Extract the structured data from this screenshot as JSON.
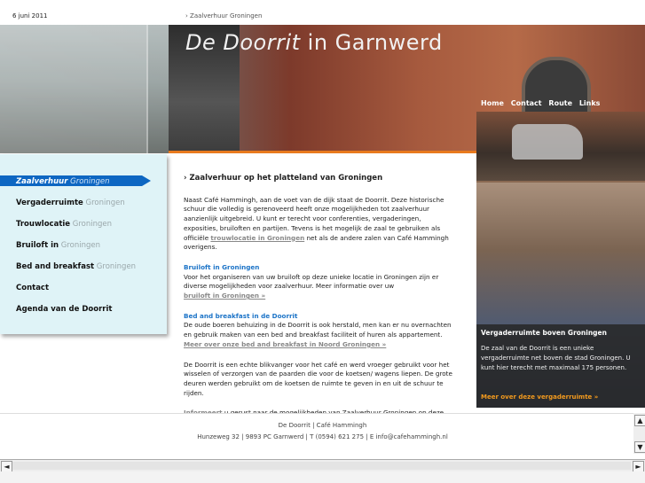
{
  "topbar": {
    "date": "6 juni 2011",
    "breadcrumb": "› Zaalverhuur Groningen"
  },
  "banner": {
    "title_italic": "De Doorrit",
    "title_rest": " in Garnwerd",
    "nav": [
      "Home",
      "Contact",
      "Route",
      "Links"
    ]
  },
  "sidebar": {
    "items": [
      {
        "main": "Zaalverhuur",
        "sub": " Groningen",
        "active": true
      },
      {
        "main": "Vergaderruimte",
        "sub": " Groningen"
      },
      {
        "main": "Trouwlocatie",
        "sub": " Groningen"
      },
      {
        "main": "Bruiloft in",
        "sub": " Groningen"
      },
      {
        "main": "Bed and breakfast",
        "sub": " Groningen"
      },
      {
        "main": "Contact",
        "sub": ""
      },
      {
        "main": "Agenda van de Doorrit",
        "sub": ""
      }
    ]
  },
  "content": {
    "heading": "› Zaalverhuur op het platteland van Groningen",
    "p1": "Naast Café Hammingh, aan de voet van de dijk staat de Doorrit. Deze historische schuur die volledig is gerenoveerd heeft onze mogelijkheden tot zaalverhuur aanzienlijk uitgebreid. U kunt er terecht voor conferenties, vergaderingen, exposities, bruiloften en partijen. Tevens is het mogelijk de zaal te gebruiken als officiële ",
    "p1_link": "trouwlocatie in Groningen",
    "p1_end": " net als de andere zalen van Café Hammingh overigens.",
    "h2": "Bruiloft in Groningen",
    "p2": "Voor het organiseren van uw bruiloft op deze unieke locatie in Groningen zijn er diverse mogelijkheden voor zaalverhuur. Meer informatie over uw",
    "p2_link": "bruiloft in Groningen »",
    "h3": "Bed and breakfast in de Doorrit",
    "p3": "De oude boeren behuizing in de Doorrit is ook herstald, men kan er nu overnachten en gebruik maken van een bed and breakfast faciliteit of huren als appartement. ",
    "p3_link": "Meer over onze bed and breakfast in Noord Groningen »",
    "p4": "De Doorrit is een echte blikvanger voor het café en werd vroeger gebruikt voor het wisselen of verzorgen van de paarden die voor de koetsen/ wagens liepen. De grote deuren werden gebruikt om de koetsen de ruimte te geven in en uit de schuur te rijden.",
    "p5_link": "Informeert",
    "p5": " u gerust naar de mogelijkheden van Zaalverhuur Groningen op deze unieke lokatie in Noord Groningen."
  },
  "right": {
    "caption_title": "Vergaderruimte boven Groningen",
    "caption_text": "De zaal van de Doorrit is een unieke vergaderruimte net boven de stad Groningen. U kunt hier terecht met maximaal 175 personen.",
    "caption_link": "Meer over deze vergaderruimte »"
  },
  "footer": {
    "line1": "De Doorrit | Café Hammingh",
    "line2": "Hunzeweg 32 | 9893 PC Garnwerd | T (0594) 621 275 | E info@cafehammingh.nl"
  },
  "icons": {
    "scroll_up": "▲",
    "scroll_down": "▼",
    "scroll_left": "◄",
    "scroll_right": "►"
  }
}
